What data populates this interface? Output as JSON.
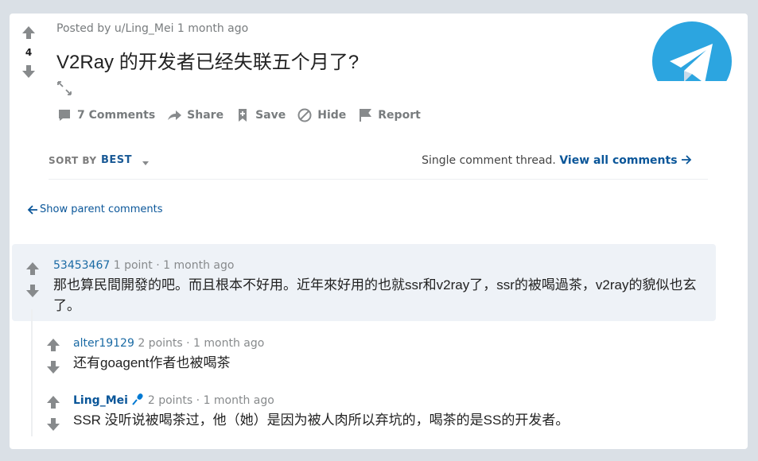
{
  "post": {
    "score": "4",
    "meta": "Posted by u/Ling_Mei 1 month ago",
    "title": "V2Ray 的开发者已经失联五个月了?",
    "actions": {
      "comments": "7 Comments",
      "share": "Share",
      "save": "Save",
      "hide": "Hide",
      "report": "Report"
    }
  },
  "sort": {
    "label": "SORT BY",
    "value": "BEST",
    "thread_text": "Single comment thread.",
    "view_all": "View all comments"
  },
  "parent_link": "Show parent comments",
  "comments": [
    {
      "user": "53453467",
      "points": "1 point",
      "sep": "·",
      "time": "1 month ago",
      "body": "那也算民間開發的吧。而且根本不好用。近年來好用的也就ssr和v2ray了，ssr的被喝過茶，v2ray的貌似也玄了。"
    },
    {
      "user": "alter19129",
      "points": "2 points",
      "sep": "·",
      "time": "1 month ago",
      "body": "还有goagent作者也被喝茶"
    },
    {
      "user": "Ling_Mei",
      "points": "2 points",
      "sep": "·",
      "time": "1 month ago",
      "body": "SSR 没听说被喝茶过，他（她）是因为被人肉所以弃坑的，喝茶的是SS的开发者。"
    }
  ],
  "colors": {
    "background": "#dae0e6",
    "card": "#ffffff",
    "link": "#0a5699",
    "highlight": "#eef2f7",
    "telegram": "#2ca5e0"
  }
}
